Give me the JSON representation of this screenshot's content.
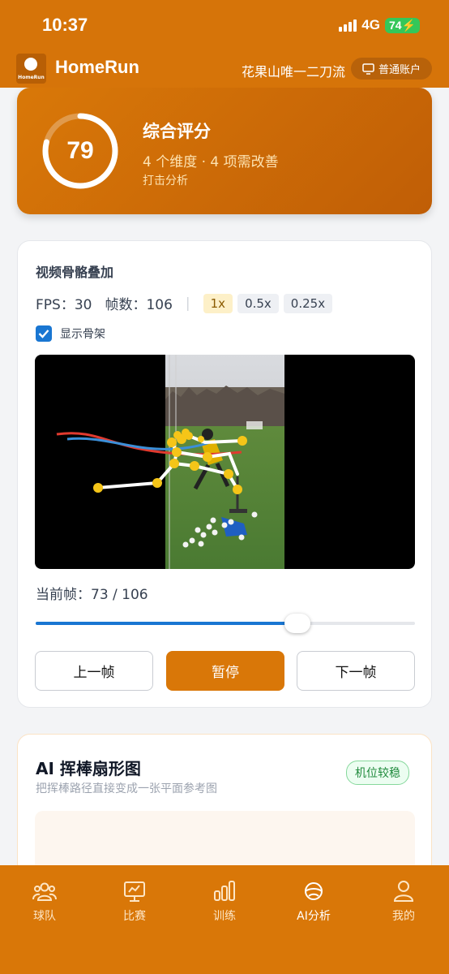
{
  "status_bar": {
    "time": "10:37",
    "network": "4G",
    "battery": "74"
  },
  "app": {
    "name": "HomeRun",
    "logo_text": "HomeRun",
    "user_name": "花果山唯一二刀流",
    "account_label": "普通账户"
  },
  "score": {
    "value": "79",
    "progress": 0.79,
    "title": "综合评分",
    "subtitle": "4 个维度 · 4 项需改善",
    "tag": "打击分析"
  },
  "video_card": {
    "title": "视频骨骼叠加",
    "fps": "FPS：30",
    "frames": "帧数：106",
    "separator": "|",
    "speeds": [
      "1x",
      "0.5x",
      "0.25x"
    ],
    "active_speed": "1x",
    "show_skeleton_label": "显示骨架",
    "show_skeleton": true,
    "current_frame_label": "当前帧：73 / 106",
    "current_frame": 73,
    "total_frames": 106,
    "prev_label": "上一帧",
    "pause_label": "暂停",
    "next_label": "下一帧"
  },
  "ai_card": {
    "title": "AI 挥棒扇形图",
    "subtitle": "把挥棒路径直接变成一张平面参考图",
    "badge": "机位较稳"
  },
  "nav": {
    "items": [
      {
        "label": "球队",
        "icon": "team-icon"
      },
      {
        "label": "比赛",
        "icon": "match-icon"
      },
      {
        "label": "训练",
        "icon": "training-icon"
      },
      {
        "label": "AI分析",
        "icon": "ai-analysis-icon"
      },
      {
        "label": "我的",
        "icon": "profile-icon"
      }
    ],
    "active": "AI分析"
  },
  "colors": {
    "brand": "#d97708",
    "accent_blue": "#1976d2",
    "badge_green": "#1f8a3c"
  }
}
